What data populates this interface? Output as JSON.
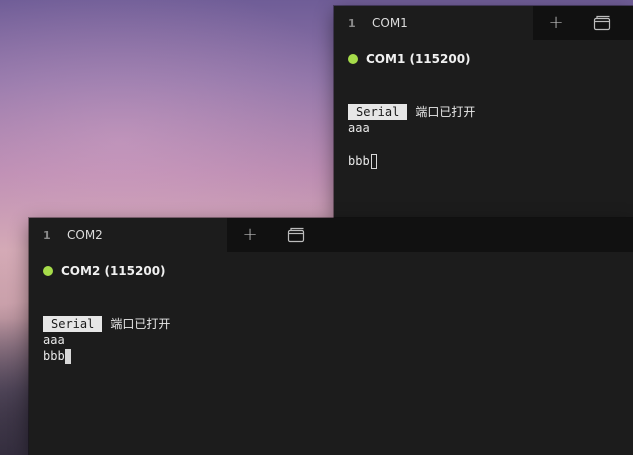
{
  "windows": [
    {
      "tab_index": "1",
      "tab_title": "COM1",
      "status": "COM1 (115200)",
      "status_color": "#a6dc4a",
      "serial_tag": "Serial",
      "serial_message": "端口已打开",
      "lines": [
        "aaa",
        "bbb"
      ]
    },
    {
      "tab_index": "1",
      "tab_title": "COM2",
      "status": "COM2 (115200)",
      "status_color": "#a6dc4a",
      "serial_tag": "Serial",
      "serial_message": "端口已打开",
      "lines": [
        "aaa",
        "bbb"
      ]
    }
  ],
  "icons": {
    "add": "plus-icon",
    "window": "new-window-icon"
  }
}
